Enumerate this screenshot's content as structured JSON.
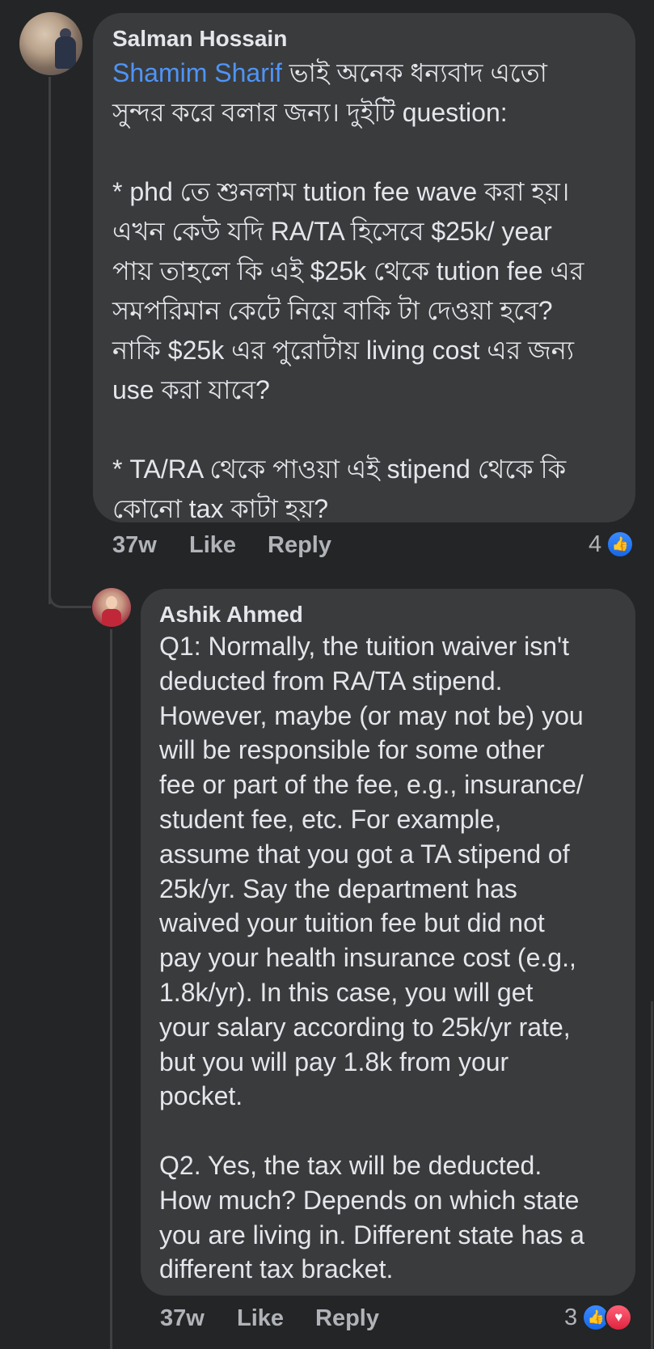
{
  "comments": [
    {
      "author": "Salman Hossain",
      "mention": "Shamim Sharif",
      "text": " ভাই অনেক ধন্যবাদ এতো\nসুন্দর করে বলার জন্য। দুইটি question:\n\n* phd তে শুনলাম tution fee wave করা হয়।\nএখন কেউ যদি RA/TA হিসেবে $25k/ year\nপায় তাহলে কি এই $25k থেকে tution fee এর\nসমপরিমান কেটে নিয়ে বাকি টা দেওয়া হবে?\nনাকি $25k এর পুরোটায় living cost এর জন্য\nuse করা যাবে?\n\n* TA/RA থেকে পাওয়া এই stipend থেকে কি\nকোনো tax কাটা হয়?",
      "time": "37w",
      "like_label": "Like",
      "reply_label": "Reply",
      "reaction_count": "4",
      "reactions": [
        "like-icon"
      ]
    },
    {
      "author": "Ashik Ahmed",
      "text": "Q1: Normally, the tuition waiver isn't\ndeducted from RA/TA stipend.\nHowever, maybe (or may not be) you\nwill be responsible for some other\nfee or part of the fee, e.g., insurance/\nstudent fee, etc. For example,\nassume that you got a TA stipend of\n25k/yr. Say the department has\nwaived your tuition fee but did not\npay your health insurance cost (e.g.,\n1.8k/yr). In this case, you will get\nyour salary according to 25k/yr rate,\nbut you will pay 1.8k from your\npocket.\n\nQ2. Yes, the tax will be deducted.\nHow much? Depends on which state\nyou are living in. Different state has a\ndifferent tax bracket.",
      "time": "37w",
      "like_label": "Like",
      "reply_label": "Reply",
      "reaction_count": "3",
      "reactions": [
        "like-icon",
        "love-icon"
      ]
    }
  ]
}
